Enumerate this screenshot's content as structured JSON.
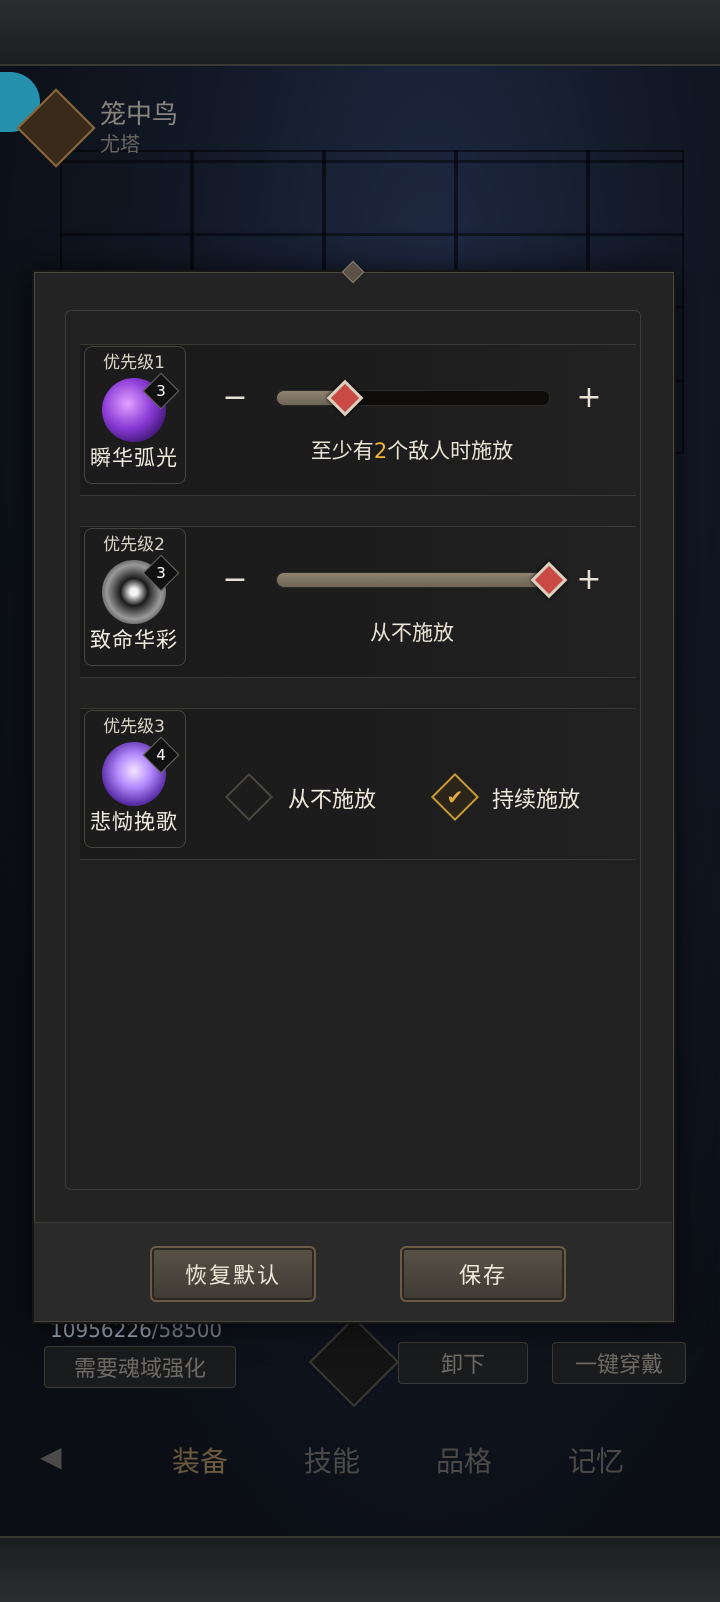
{
  "header": {
    "character_name": "笼中鸟",
    "character_subtitle": "尤塔"
  },
  "background": {
    "gold": "10956226",
    "gold_required": "/58500",
    "soul_button": "需要魂域强化",
    "unequip_button": "卸下",
    "equip_all_button": "一键穿戴",
    "tabs": [
      "装备",
      "技能",
      "品格",
      "记忆"
    ]
  },
  "dialog": {
    "skills": [
      {
        "priority": "优先级1",
        "name": "瞬华弧光",
        "level": "3",
        "icon": "purple-arc-icon",
        "mode": "slider",
        "slider_fraction": 0.25,
        "desc_prefix": "至少有",
        "desc_value": "2",
        "desc_suffix": "个敌人时施放"
      },
      {
        "priority": "优先级2",
        "name": "致命华彩",
        "level": "3",
        "icon": "burst-icon",
        "mode": "slider",
        "slider_fraction": 1.0,
        "desc": "从不施放"
      },
      {
        "priority": "优先级3",
        "name": "悲恸挽歌",
        "level": "4",
        "icon": "violet-fan-icon",
        "mode": "toggle",
        "option_off": "从不施放",
        "option_on": "持续施放",
        "selected": "持续施放"
      }
    ],
    "minus_symbol": "−",
    "plus_symbol": "+",
    "check_symbol": "✔",
    "reset_button": "恢复默认",
    "save_button": "保存"
  },
  "colors": {
    "accent": "#f2b53a",
    "knob": "#c94a44"
  }
}
